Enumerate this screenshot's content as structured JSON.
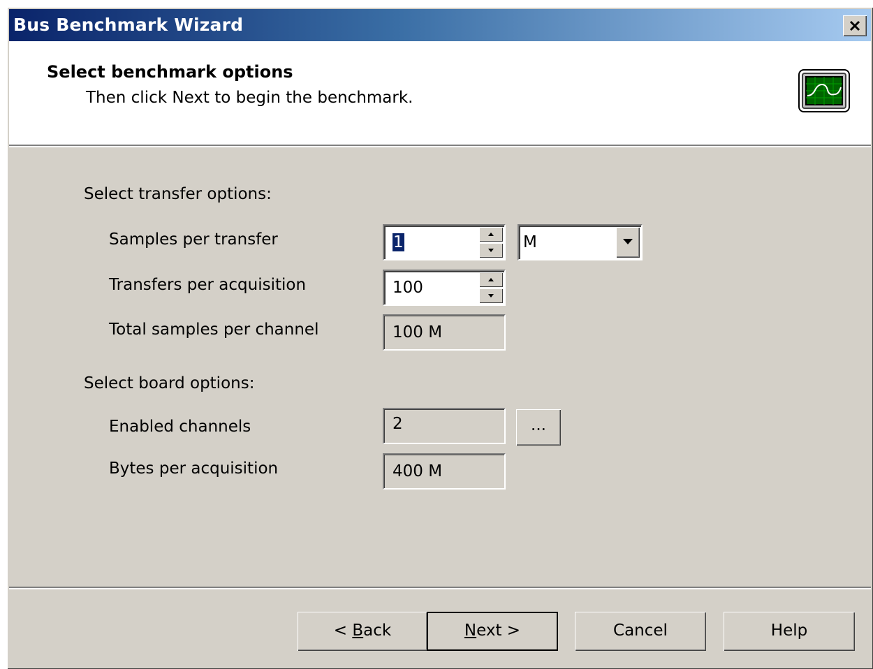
{
  "window": {
    "title": "Bus Benchmark Wizard",
    "close_symbol": "×"
  },
  "header": {
    "title": "Select benchmark options",
    "subtitle": "Then click Next to begin the benchmark.",
    "icon": "oscilloscope-icon"
  },
  "transfer": {
    "section_label": "Select transfer options:",
    "samples_per_transfer": {
      "label": "Samples per transfer",
      "value": "1",
      "unit_selected": "M"
    },
    "transfers_per_acquisition": {
      "label": "Transfers per acquisition",
      "value": "100"
    },
    "total_samples": {
      "label": "Total samples per channel",
      "value": "100 M"
    }
  },
  "board": {
    "section_label": "Select board options:",
    "enabled_channels": {
      "label": "Enabled channels",
      "value": "2",
      "browse_label": "..."
    },
    "bytes_per_acquisition": {
      "label": "Bytes per acquisition",
      "value": "400 M"
    }
  },
  "footer": {
    "back_prefix": "< ",
    "back_accel": "B",
    "back_rest": "ack",
    "next_accel": "N",
    "next_rest": "ext >",
    "cancel_label": "Cancel",
    "help_label": "Help"
  },
  "colors": {
    "dialog_bg": "#d4d0c8",
    "title_gradient_start": "#0a246a",
    "title_gradient_end": "#a6caf0",
    "selection": "#0a246a"
  }
}
